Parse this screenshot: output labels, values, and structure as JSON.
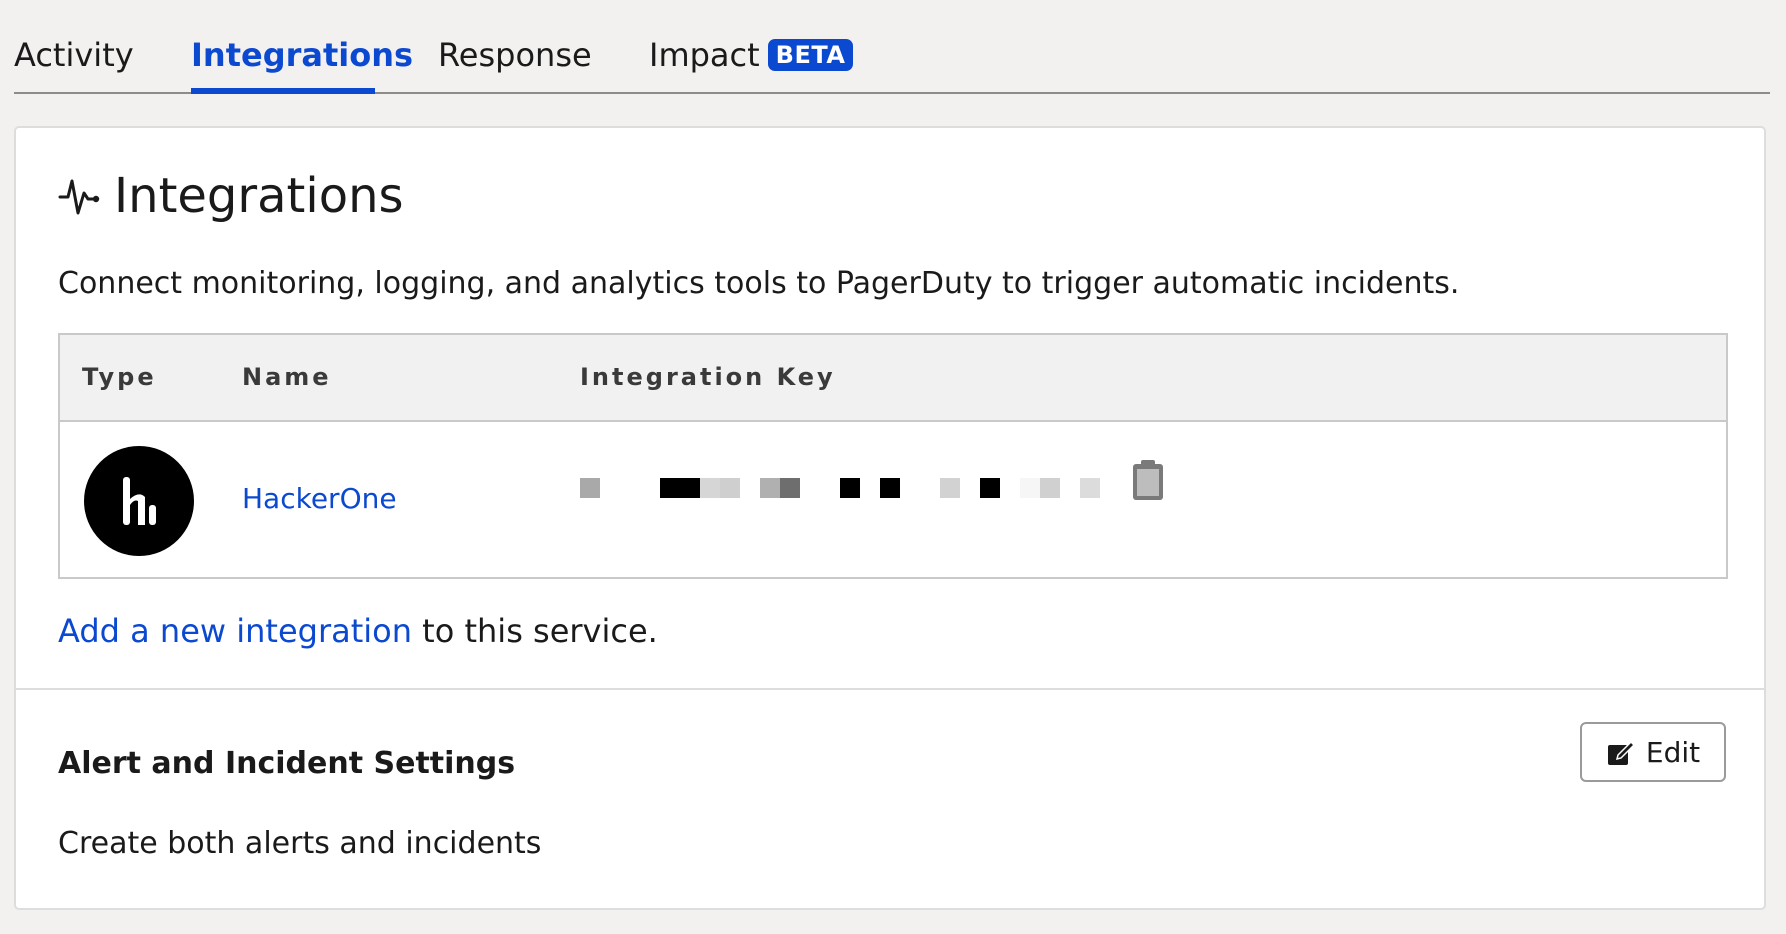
{
  "tabs": [
    {
      "label": "Activity"
    },
    {
      "label": "Integrations"
    },
    {
      "label": "Response"
    },
    {
      "label": "Impact",
      "badge": "BETA"
    }
  ],
  "active_tab": "Integrations",
  "integrations": {
    "icon": "pulse-icon",
    "title": "Integrations",
    "description": "Connect monitoring, logging, and analytics tools to PagerDuty to trigger automatic incidents.",
    "table": {
      "headers": [
        "Type",
        "Name",
        "Integration Key"
      ],
      "rows": [
        {
          "type_icon": "hackerone-logo",
          "name": "HackerOne",
          "key_icon": "clipboard-icon"
        }
      ]
    },
    "add_link": "Add a new integration",
    "add_suffix": " to this service."
  },
  "settings": {
    "title": "Alert and Incident Settings",
    "value": "Create both alerts and incidents",
    "edit_label": "Edit",
    "edit_icon": "edit-icon"
  },
  "colors": {
    "accent": "#0b49d1",
    "background": "#f3f1f0"
  }
}
